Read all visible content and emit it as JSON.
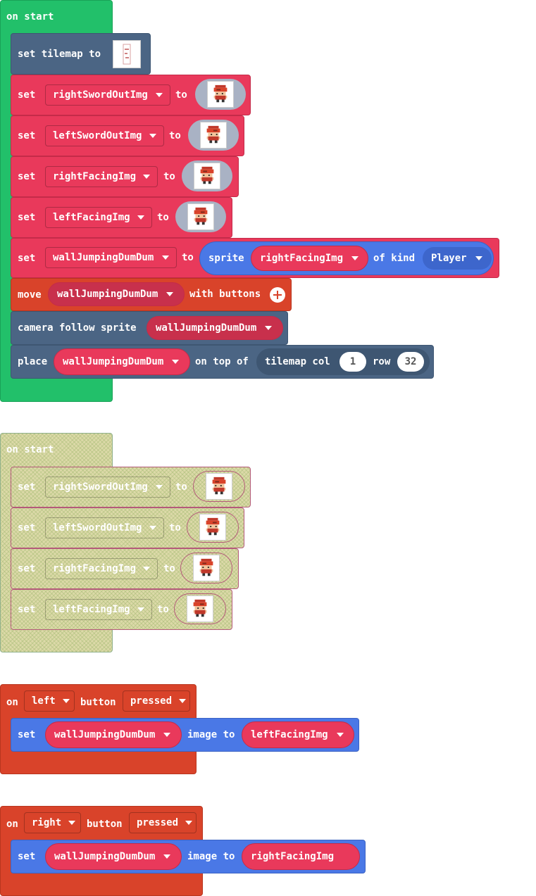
{
  "colors": {
    "on_start": "#22c06a",
    "set_block": "#e9395b",
    "scene": "#4b6584",
    "controller": "#d9432a",
    "sprites": "#4a78e6"
  },
  "on_start_1": {
    "hat": "on start",
    "set_tilemap": {
      "label": "set tilemap to",
      "image_icon": "tilemap-thumbnail-icon"
    },
    "set_rows": [
      {
        "set": "set",
        "var": "rightSwordOutImg",
        "to": "to",
        "image_icon": "sprite-sword-right-icon"
      },
      {
        "set": "set",
        "var": "leftSwordOutImg",
        "to": "to",
        "image_icon": "sprite-sword-left-icon"
      },
      {
        "set": "set",
        "var": "rightFacingImg",
        "to": "to",
        "image_icon": "sprite-facing-right-icon"
      },
      {
        "set": "set",
        "var": "leftFacingImg",
        "to": "to",
        "image_icon": "sprite-facing-left-icon"
      }
    ],
    "set_sprite": {
      "set": "set",
      "var": "wallJumpingDumDum",
      "to": "to",
      "sprite": "sprite",
      "img_var": "rightFacingImg",
      "of_kind": "of kind",
      "kind": "Player"
    },
    "move": {
      "move": "move",
      "var": "wallJumpingDumDum",
      "with_buttons": "with buttons"
    },
    "camera": {
      "label": "camera follow sprite",
      "var": "wallJumpingDumDum"
    },
    "place": {
      "place": "place",
      "var": "wallJumpingDumDum",
      "on_top_of": "on top of",
      "tilemap_col": "tilemap col",
      "col": "1",
      "row_label": "row",
      "row": "32"
    }
  },
  "on_start_2": {
    "hat": "on start",
    "set_rows": [
      {
        "set": "set",
        "var": "rightSwordOutImg",
        "to": "to"
      },
      {
        "set": "set",
        "var": "leftSwordOutImg",
        "to": "to"
      },
      {
        "set": "set",
        "var": "rightFacingImg",
        "to": "to"
      },
      {
        "set": "set",
        "var": "leftFacingImg",
        "to": "to"
      }
    ]
  },
  "on_left": {
    "on": "on",
    "button": "left",
    "button_label": "button",
    "event": "pressed",
    "set": "set",
    "var": "wallJumpingDumDum",
    "image_to": "image to",
    "img_var": "leftFacingImg"
  },
  "on_right": {
    "on": "on",
    "button": "right",
    "button_label": "button",
    "event": "pressed",
    "set": "set",
    "var": "wallJumpingDumDum",
    "image_to": "image to",
    "img_var": "rightFacingImg"
  }
}
